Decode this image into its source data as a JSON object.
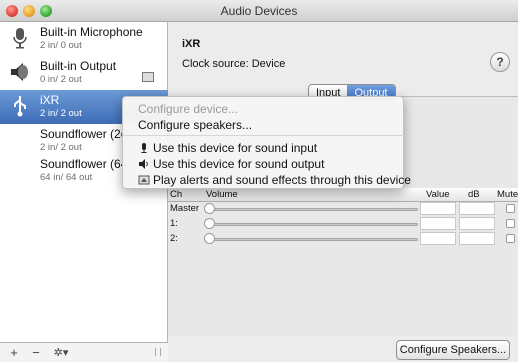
{
  "window": {
    "title": "Audio Devices"
  },
  "sidebar": {
    "devices": [
      {
        "name": "Built-in Microphone",
        "io": "2 in/ 0 out",
        "icon": "microphone-icon"
      },
      {
        "name": "Built-in Output",
        "io": "0 in/ 2 out",
        "icon": "speaker-icon"
      },
      {
        "name": "iXR",
        "io": "2 in/ 2 out",
        "icon": "usb-icon"
      },
      {
        "name": "Soundflower (2ch)",
        "io": "2 in/ 2 out",
        "icon": ""
      },
      {
        "name": "Soundflower (64ch)",
        "io": "64 in/ 64 out",
        "icon": ""
      }
    ],
    "footer": {
      "add": "+",
      "remove": "−",
      "gear": "✲▾"
    }
  },
  "main": {
    "device_name": "iXR",
    "clock_source": "Clock source: Device",
    "help": "?",
    "tabs": [
      {
        "label": "Input"
      },
      {
        "label": "Output"
      }
    ],
    "table": {
      "headers": {
        "ch": "Ch",
        "volume": "Volume",
        "value": "Value",
        "db": "dB",
        "mute": "Mute"
      },
      "rows": [
        {
          "label": "Master"
        },
        {
          "label": "1:"
        },
        {
          "label": "2:"
        }
      ]
    },
    "configure_speakers_button": "Configure Speakers..."
  },
  "context_menu": {
    "items": [
      {
        "label": "Configure device...",
        "disabled": true
      },
      {
        "label": "Configure speakers...",
        "disabled": false
      },
      {
        "label": "Use this device for sound input",
        "icon": "microphone-icon"
      },
      {
        "label": "Use this device for sound output",
        "icon": "speaker-icon"
      },
      {
        "label": "Play alerts and sound effects through this device",
        "icon": "alert-icon"
      }
    ]
  },
  "colors": {
    "selection": "#3e6cb6",
    "tab_active": "#3f72c2"
  }
}
